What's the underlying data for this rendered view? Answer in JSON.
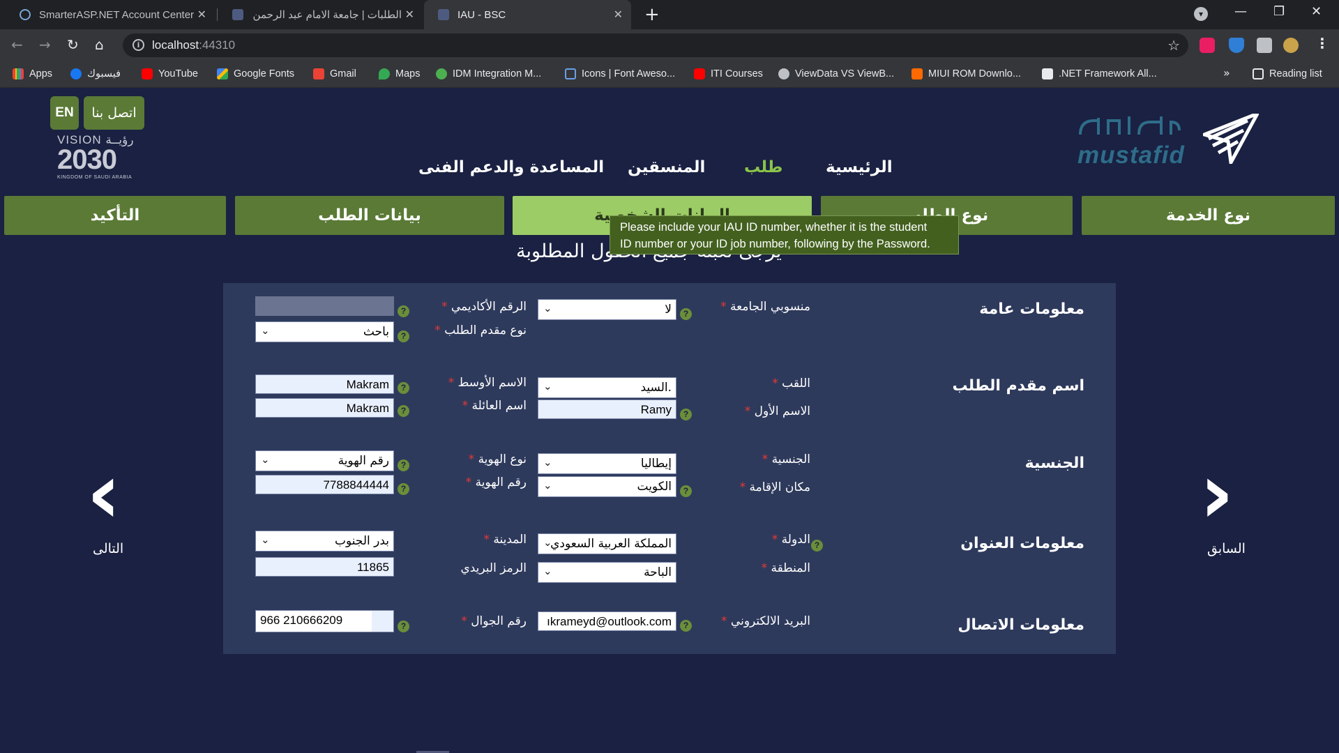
{
  "browser": {
    "tabs": [
      {
        "title": "SmarterASP.NET Account Center",
        "active": false
      },
      {
        "title": "الطلبات | جامعة الامام عبد الرحمن",
        "active": false
      },
      {
        "title": "IAU - BSC",
        "active": true
      }
    ],
    "url": {
      "host": "localhost",
      "port": ":44310"
    },
    "bookmarks": [
      "Apps",
      "فيسبوك",
      "YouTube",
      "Google Fonts",
      "Gmail",
      "Maps",
      "IDM Integration M...",
      "Icons | Font Aweso...",
      "ITI Courses",
      "ViewData VS ViewB...",
      "MIUI ROM Downlo...",
      ".NET Framework All..."
    ],
    "bookmarks_more": "»",
    "reading_list": "Reading list"
  },
  "header": {
    "lang_button": "EN",
    "contact_button": "اتصل بنا",
    "vision_line1": "VISION رؤيــة",
    "vision_year": "2030",
    "vision_line3": "KINGDOM OF SAUDI ARABIA",
    "logo_text": "mustafid",
    "nav": [
      {
        "label": "الرئيسية",
        "active": false
      },
      {
        "label": "طلب",
        "active": true
      },
      {
        "label": "المنسقين",
        "active": false
      },
      {
        "label": "المساعدة والدعم الفنى",
        "active": false
      }
    ]
  },
  "steps": [
    "نوع الخدمة",
    "نوع الطلب",
    "البيانات الشخصية",
    "بيانات الطلب",
    "التأكيد"
  ],
  "active_step": "البيانات الشخصية",
  "tooltip": {
    "line1": "Please include your IAU ID number, whether it is the student",
    "line2": "ID number or your ID job number, following by the Password."
  },
  "subtitle": "يرجى تعبئة جميع الحقول المطلوبة",
  "form": {
    "sections": {
      "general": "معلومات عامة",
      "applicant_name": "اسم مقدم الطلب",
      "nationality": "الجنسية",
      "address": "معلومات العنوان",
      "contact": "معلومات الاتصال"
    },
    "fields": {
      "university_affiliate": {
        "label": "منسوبي الجامعة",
        "value": "لا"
      },
      "academic_number": {
        "label": "الرقم الأكاديمي",
        "value": ""
      },
      "applicant_type": {
        "label": "نوع مقدم الطلب",
        "value": "باحث"
      },
      "title": {
        "label": "اللقب",
        "value": "السيد."
      },
      "first_name": {
        "label": "الاسم الأول",
        "value": "Ramy"
      },
      "middle_name": {
        "label": "الاسم الأوسط",
        "value": "Makram"
      },
      "family_name": {
        "label": "اسم العائلة",
        "value": "Makram"
      },
      "nationality": {
        "label": "الجنسية",
        "value": "إيطاليا"
      },
      "residence": {
        "label": "مكان الإقامة",
        "value": "الكويت"
      },
      "id_type": {
        "label": "نوع الهوية",
        "value": "رقم الهوية"
      },
      "id_number": {
        "label": "رقم الهوية",
        "value": "7788844444"
      },
      "country": {
        "label": "الدولة",
        "value": "المملكة العربية السعودي"
      },
      "region": {
        "label": "المنطقة",
        "value": "الباحة"
      },
      "city": {
        "label": "المدينة",
        "value": "بدر الجنوب"
      },
      "postal_code": {
        "label": "الرمز البريدي",
        "value": "11865"
      },
      "email": {
        "label": "البريد الالكتروني",
        "value": "ıkrameyd@outlook.com"
      },
      "mobile": {
        "label": "رقم الجوال",
        "value": "966 210666209"
      }
    }
  },
  "pager": {
    "next": "التالى",
    "prev": "السابق"
  }
}
